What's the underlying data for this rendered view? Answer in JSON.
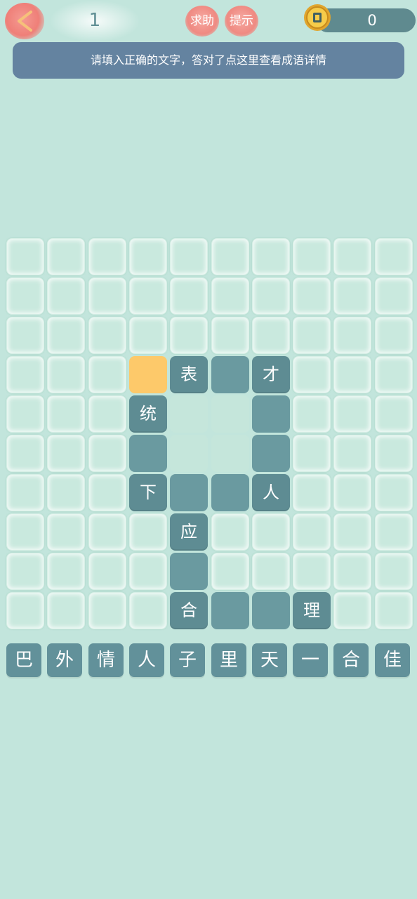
{
  "header": {
    "level": "1",
    "help_label": "求助",
    "hint_label": "提示",
    "coins": "0",
    "icons": {
      "back": "back-arrow-icon",
      "coin": "coin-icon"
    }
  },
  "banner": {
    "text": "请填入正确的文字，答对了点这里查看成语详情"
  },
  "colors": {
    "background": "#c2e5dc",
    "filled_cell": "#5e8c93",
    "selected_cell": "#fdc96a",
    "banner": "#6483a0",
    "button": "#ef8a82"
  },
  "grid": {
    "rows": 10,
    "cols": 10,
    "cells": [
      {
        "row": 3,
        "col": 3,
        "char": "",
        "state": "selected"
      },
      {
        "row": 3,
        "col": 4,
        "char": "表",
        "state": "filled"
      },
      {
        "row": 3,
        "col": 5,
        "char": "",
        "state": "blank"
      },
      {
        "row": 3,
        "col": 6,
        "char": "才",
        "state": "filled"
      },
      {
        "row": 4,
        "col": 3,
        "char": "统",
        "state": "filled"
      },
      {
        "row": 4,
        "col": 4,
        "char": "",
        "state": "input"
      },
      {
        "row": 4,
        "col": 5,
        "char": "",
        "state": "input"
      },
      {
        "row": 4,
        "col": 6,
        "char": "",
        "state": "blank"
      },
      {
        "row": 5,
        "col": 3,
        "char": "",
        "state": "blank"
      },
      {
        "row": 5,
        "col": 4,
        "char": "",
        "state": "input"
      },
      {
        "row": 5,
        "col": 5,
        "char": "",
        "state": "input"
      },
      {
        "row": 5,
        "col": 6,
        "char": "",
        "state": "blank"
      },
      {
        "row": 6,
        "col": 3,
        "char": "下",
        "state": "filled"
      },
      {
        "row": 6,
        "col": 4,
        "char": "",
        "state": "blank"
      },
      {
        "row": 6,
        "col": 5,
        "char": "",
        "state": "blank"
      },
      {
        "row": 6,
        "col": 6,
        "char": "人",
        "state": "filled"
      },
      {
        "row": 7,
        "col": 4,
        "char": "应",
        "state": "filled"
      },
      {
        "row": 8,
        "col": 4,
        "char": "",
        "state": "blank"
      },
      {
        "row": 9,
        "col": 4,
        "char": "合",
        "state": "filled"
      },
      {
        "row": 9,
        "col": 5,
        "char": "",
        "state": "blank"
      },
      {
        "row": 9,
        "col": 6,
        "char": "",
        "state": "blank"
      },
      {
        "row": 9,
        "col": 7,
        "char": "理",
        "state": "filled"
      }
    ]
  },
  "choices": [
    "巴",
    "外",
    "情",
    "人",
    "子",
    "里",
    "天",
    "一",
    "合",
    "佳"
  ]
}
